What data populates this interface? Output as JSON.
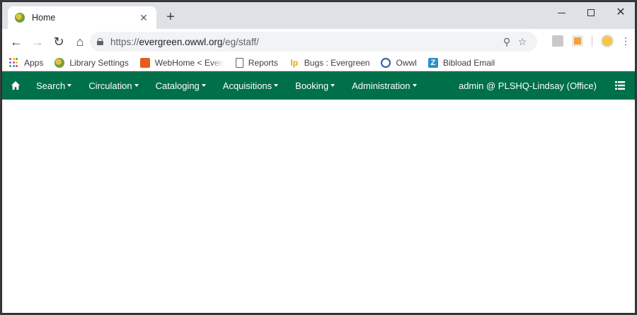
{
  "browser": {
    "tab": {
      "title": "Home",
      "close_glyph": "✕"
    },
    "new_tab_glyph": "+",
    "window_controls": {
      "close_glyph": "✕"
    },
    "url": {
      "scheme": "https://",
      "host": "evergreen.owwl.org",
      "path": "/eg/staff/"
    },
    "nav_glyphs": {
      "back": "←",
      "forward": "→",
      "reload": "↻",
      "home": "⌂"
    },
    "omnibox_glyphs": {
      "zoom": "⚲",
      "star": "☆"
    },
    "menu_glyph": "⋮",
    "bookmarks": [
      {
        "label": "Apps",
        "icon": "apps-grid-icon"
      },
      {
        "label": "Library Settings",
        "icon": "library-settings-icon"
      },
      {
        "label": "WebHome < Evergreen",
        "icon": "webhome-icon"
      },
      {
        "label": "Reports",
        "icon": "document-icon"
      },
      {
        "label": "Bugs : Evergreen",
        "icon": "launchpad-icon",
        "glyph": "lp"
      },
      {
        "label": "Owwl",
        "icon": "owwl-icon"
      },
      {
        "label": "Bibload Email",
        "icon": "zimbra-icon",
        "glyph": "Z"
      }
    ],
    "apps_colors": [
      "#ea4335",
      "#fbbc04",
      "#34a853",
      "#4285f4",
      "#ea4335",
      "#fbbc04",
      "#34a853",
      "#4285f4",
      "#ea4335"
    ]
  },
  "app": {
    "nav_color": "#00704a",
    "menu": [
      {
        "label": "Search",
        "key": "search"
      },
      {
        "label": "Circulation",
        "key": "circulation"
      },
      {
        "label": "Cataloging",
        "key": "cataloging"
      },
      {
        "label": "Acquisitions",
        "key": "acquisitions"
      },
      {
        "label": "Booking",
        "key": "booking"
      },
      {
        "label": "Administration",
        "key": "administration"
      }
    ],
    "user": "admin @ PLSHQ-Lindsay (Office)"
  }
}
